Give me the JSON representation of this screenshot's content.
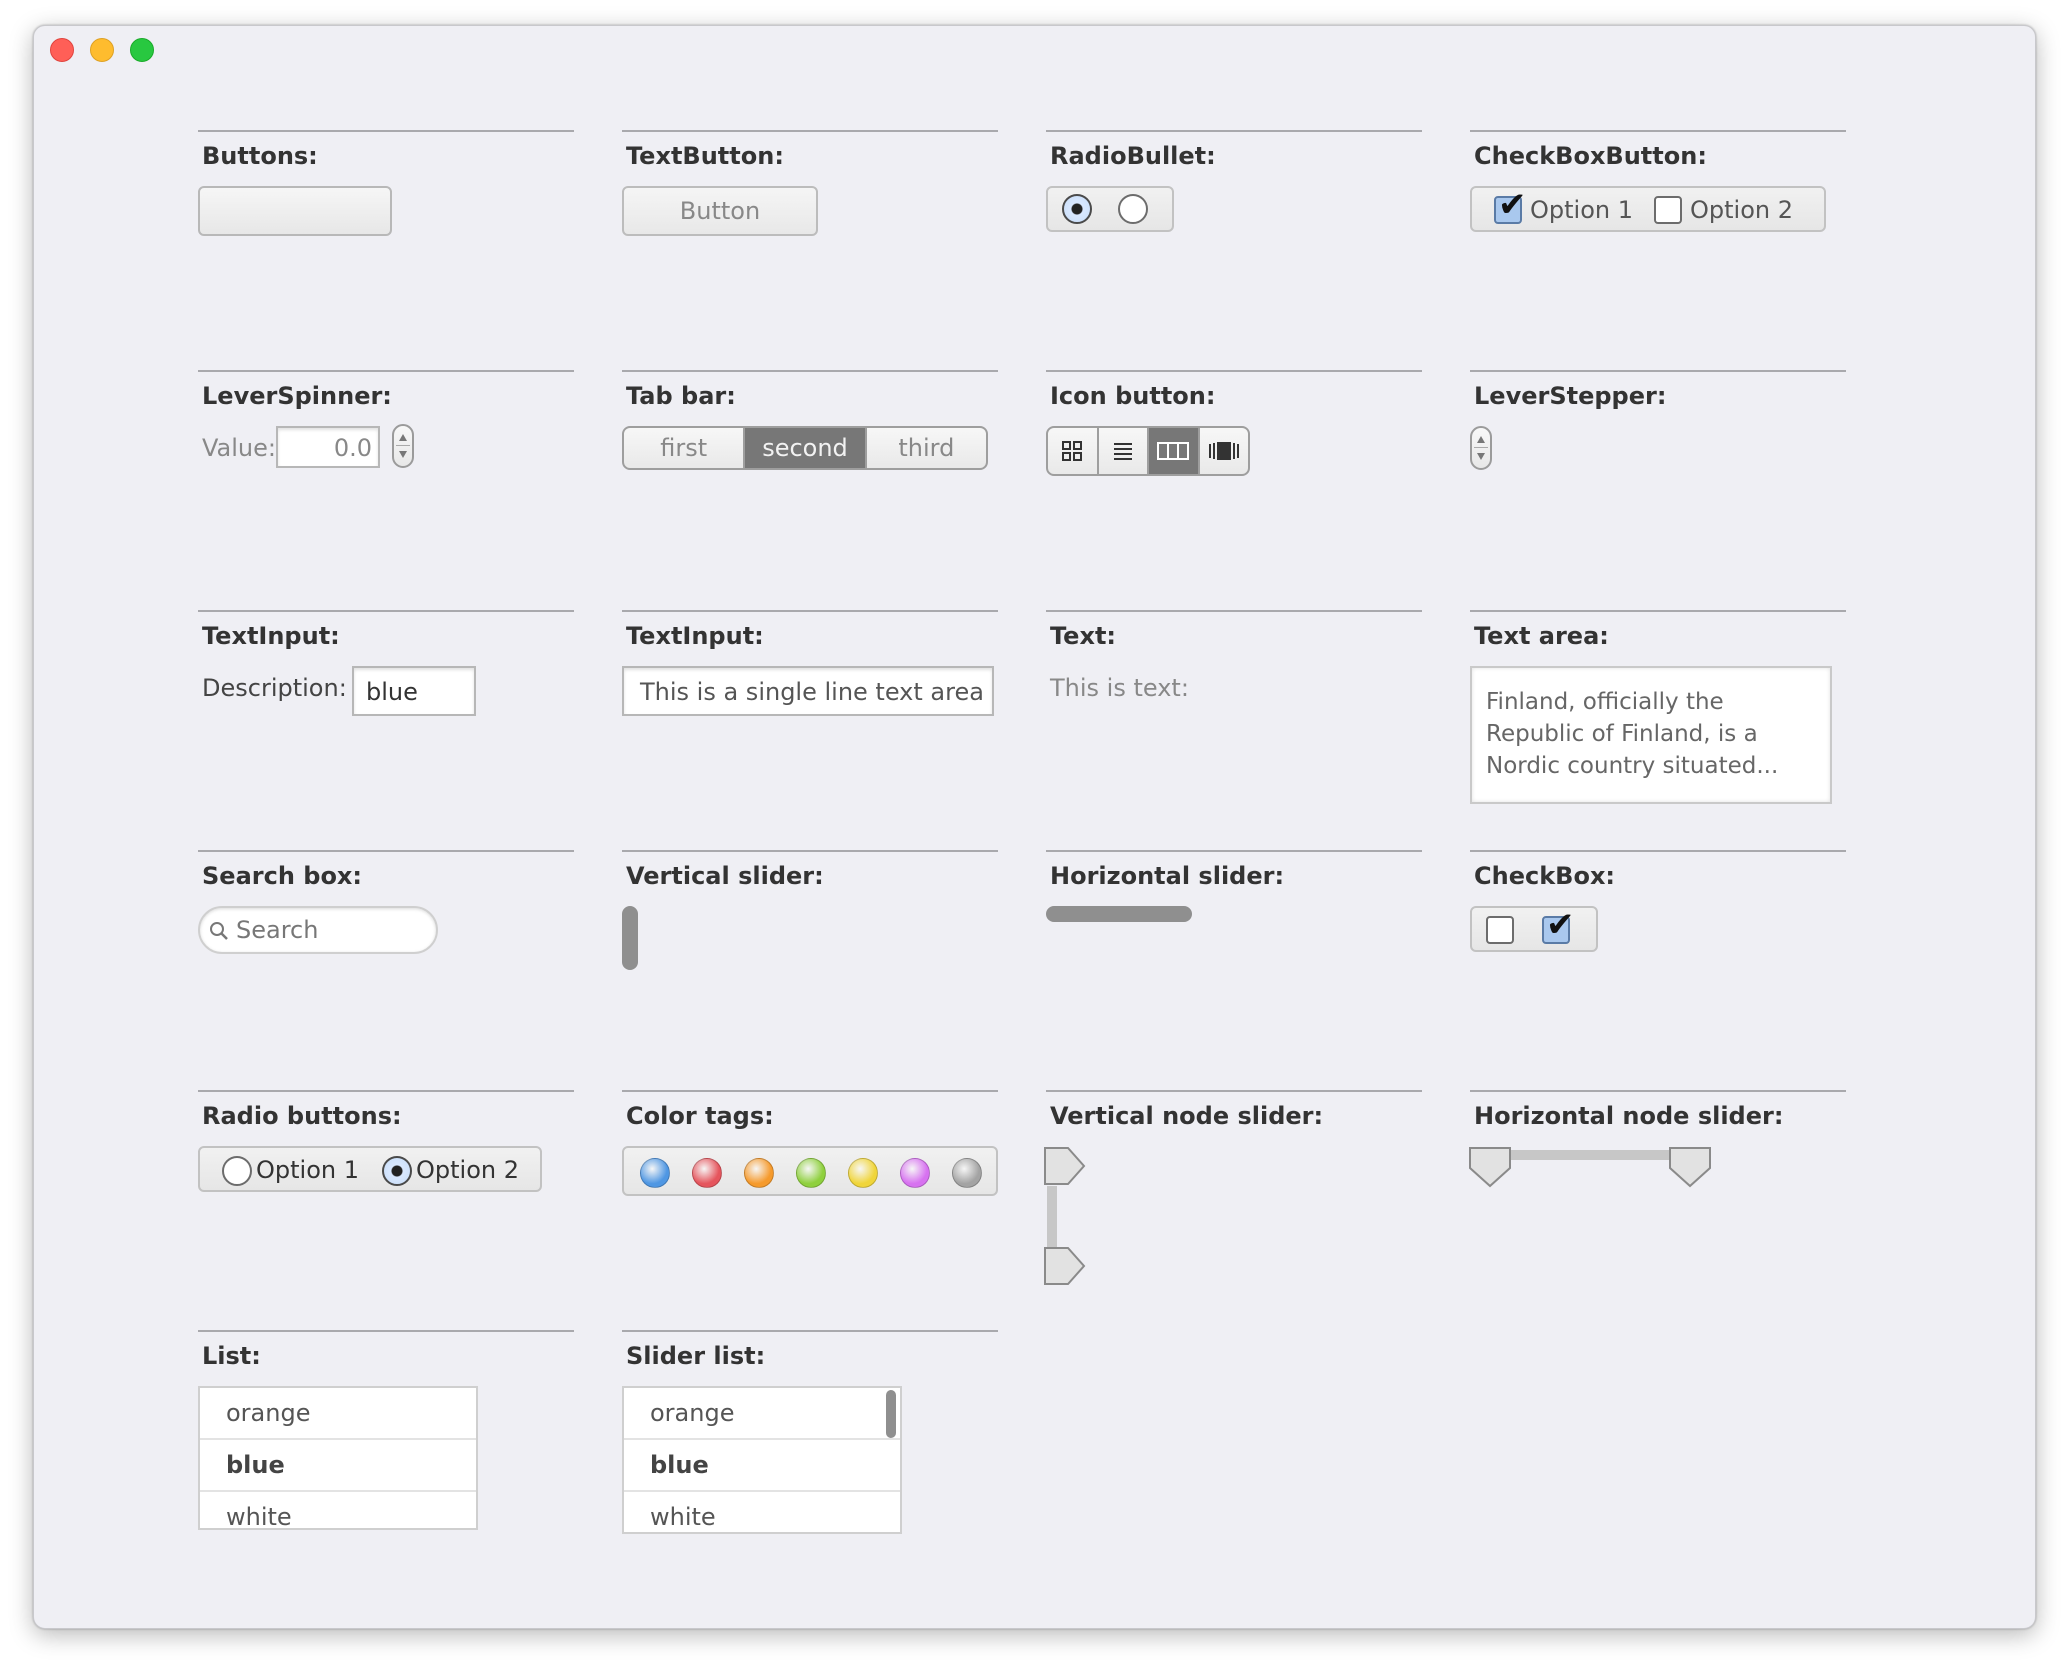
{
  "window": {
    "controls": [
      "close",
      "minimize",
      "maximize"
    ]
  },
  "sections": {
    "buttons": {
      "title": "Buttons:"
    },
    "text_button": {
      "title": "TextButton:",
      "label": "Button"
    },
    "radio_bullet": {
      "title": "RadioBullet:",
      "selected_index": 0
    },
    "checkbox_button": {
      "title": "CheckBoxButton:",
      "option1": "Option 1",
      "option2": "Option 2",
      "option1_checked": true,
      "option2_checked": false
    },
    "lever_spinner": {
      "title": "LeverSpinner:",
      "label": "Value:",
      "value": "0.0"
    },
    "tab_bar": {
      "title": "Tab bar:",
      "tabs": [
        "first",
        "second",
        "third"
      ],
      "active": "second"
    },
    "icon_button": {
      "title": "Icon button:",
      "icons": [
        "grid-view-icon",
        "list-view-icon",
        "column-view-icon",
        "cover-flow-icon"
      ],
      "active": "column-view-icon"
    },
    "lever_stepper": {
      "title": "LeverStepper:"
    },
    "text_input_1": {
      "title": "TextInput:",
      "label": "Description:",
      "value": "blue"
    },
    "text_input_2": {
      "title": "TextInput:",
      "value": "This is a single line text area"
    },
    "text": {
      "title": "Text:",
      "value": "This is text:"
    },
    "text_area": {
      "title": "Text area:",
      "lines": [
        "Finland, officially the",
        "Republic of Finland, is a",
        "Nordic country situated..."
      ]
    },
    "search_box": {
      "title": "Search box:",
      "placeholder": "Search"
    },
    "vertical_slider": {
      "title": "Vertical slider:"
    },
    "horizontal_slider": {
      "title": "Horizontal slider:"
    },
    "checkbox": {
      "title": "CheckBox:",
      "states": [
        false,
        true
      ]
    },
    "radio_buttons": {
      "title": "Radio buttons:",
      "option1": "Option 1",
      "option2": "Option 2",
      "selected": "Option 2"
    },
    "color_tags": {
      "title": "Color tags:",
      "colors": [
        "#4f97e3",
        "#e5555d",
        "#f59a2c",
        "#8fd03e",
        "#f0d53a",
        "#d772f0",
        "#a3a3a3"
      ]
    },
    "vertical_node_slider": {
      "title": "Vertical node slider:"
    },
    "horizontal_node_slider": {
      "title": "Horizontal node slider:"
    },
    "list": {
      "title": "List:",
      "items": [
        "orange",
        "blue",
        "white"
      ],
      "selected": "blue"
    },
    "slider_list": {
      "title": "Slider list:",
      "items": [
        "orange",
        "blue",
        "white"
      ],
      "selected": "blue"
    }
  }
}
